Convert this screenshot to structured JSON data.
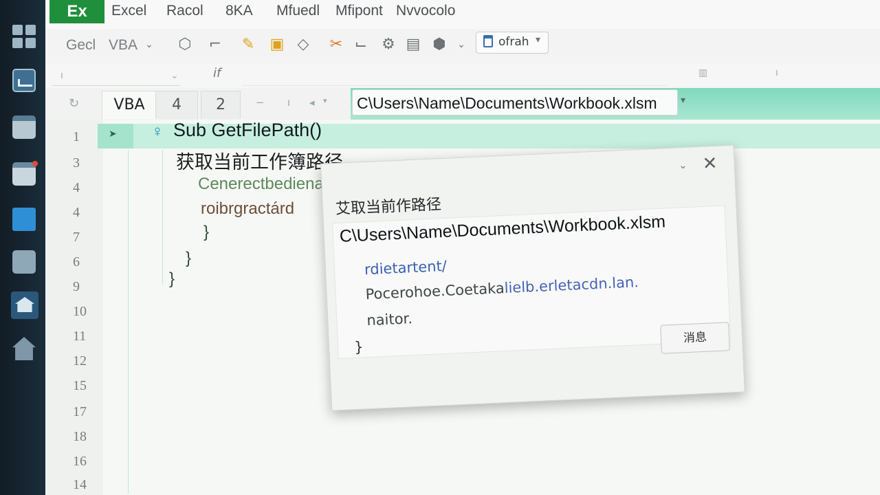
{
  "titlebar": {
    "logo": "Ex",
    "menu": [
      "Excel",
      "Racol",
      "8KA",
      "Mfuedl",
      "Mfipont",
      "Nvvocolo"
    ]
  },
  "ribbon": {
    "left_labels": [
      "Gecl",
      "VBA"
    ],
    "view_label": "ofrah"
  },
  "formula_bar": {
    "fx": "if"
  },
  "tabs": [
    {
      "label": "VBA",
      "active": true
    },
    {
      "label": "4",
      "active": false
    },
    {
      "label": "2",
      "active": false
    }
  ],
  "path_field": "C\\Users\\Name\\Documents\\Workbook.xlsm",
  "editor": {
    "line_numbers": [
      "1",
      "3",
      "4",
      "4",
      "7",
      "6",
      "9",
      "10",
      "11",
      "12",
      "15",
      "17",
      "18",
      "16",
      "14"
    ],
    "sub_line": "Sub GetFilePath()",
    "comment_cn": "获取当前工作簿路径",
    "code_line_3": "Cenerectbedienanteng?",
    "code_line_4": "roibrgractárd",
    "brace": "}"
  },
  "message_box": {
    "title": "艾取当前作路径",
    "path": "C\\Users\\Name\\Documents\\Workbook.xlsm",
    "line1": "rdietartent/",
    "line2_a": "Pocerohoe.Coetaka",
    "line2_b": "lielb.erletacdn.lan.",
    "line3": "naitor.",
    "brace": "}",
    "ok_label": "消息"
  },
  "colors": {
    "excel_green": "#1f8f3c",
    "accent_mint": "#8fe0c4",
    "taskbar": "#1d3242"
  }
}
